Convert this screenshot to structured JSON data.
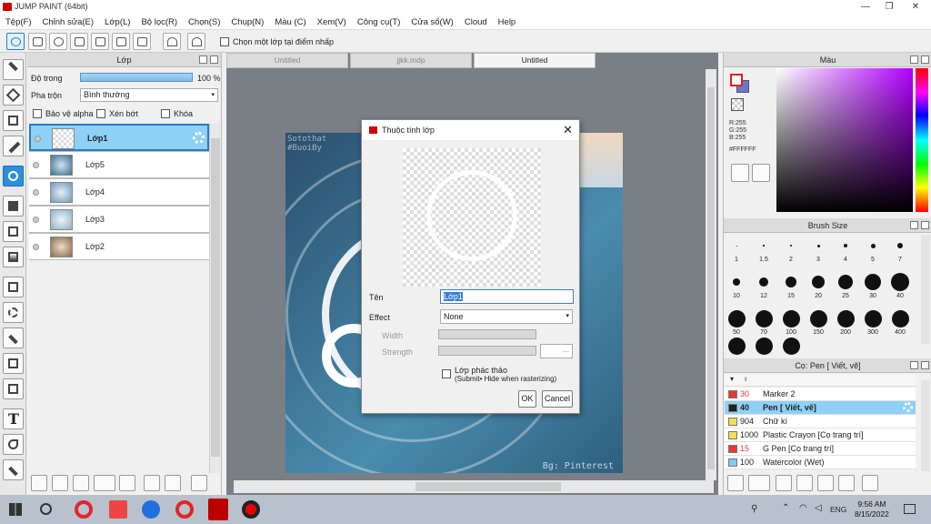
{
  "window": {
    "title": "JUMP PAINT (64bit)",
    "min": "—",
    "max": "❐",
    "close": "✕"
  },
  "menu": [
    "Tệp(F)",
    "Chỉnh sửa(E)",
    "Lớp(L)",
    "Bộ lọc(R)",
    "Chọn(S)",
    "Chụp(N)",
    "Màu (C)",
    "Xem(V)",
    "Công cụ(T)",
    "Cửa sổ(W)",
    "Cloud",
    "Help"
  ],
  "toolbar": {
    "pick_layer_label": "Chọn một lớp tại điểm nhấp"
  },
  "layer_panel": {
    "title": "Lớp",
    "opacity_label": "Độ trong",
    "opacity_value": "100 %",
    "opacity": 1.0,
    "blend_label": "Pha trộn",
    "blend_value": "Bình thường",
    "protect_alpha": "Bảo vệ alpha",
    "clipping": "Xén bớt",
    "lock": "Khóa",
    "layers": [
      {
        "name": "Lớp1",
        "active": true
      },
      {
        "name": "Lớp5",
        "active": false
      },
      {
        "name": "Lớp4",
        "active": false
      },
      {
        "name": "Lớp3",
        "active": false
      },
      {
        "name": "Lớp2",
        "active": false
      }
    ]
  },
  "tabs": [
    {
      "label": "Untitled",
      "active": false
    },
    {
      "label": "jjkk.mdp",
      "active": false
    },
    {
      "label": "Untitled",
      "active": true
    }
  ],
  "canvas": {
    "watermark_top": "Sotothat\n#BuoiBy",
    "watermark_bottom": "Bg: Pinterest"
  },
  "dialog": {
    "title": "Thuộc tính lớp",
    "name_label": "Tên",
    "name_value": "Lớp1",
    "effect_label": "Effect",
    "effect_value": "None",
    "width_label": "Width",
    "strength_label": "Strength",
    "strength_btn": "...",
    "draft_label": "Lớp phác thảo",
    "draft_sub": "(Submit• Hide when rasterizing)",
    "ok": "OK",
    "cancel": "Cancel"
  },
  "color_panel": {
    "title": "Màu",
    "r": "R:255",
    "g": "G:255",
    "b": "B:255",
    "hex": "#FFFFFF"
  },
  "brush_size_panel": {
    "title": "Brush Size",
    "sizes": [
      "1",
      "1.5",
      "2",
      "3",
      "4",
      "5",
      "7",
      "10",
      "12",
      "15",
      "20",
      "25",
      "30",
      "40",
      "50",
      "70",
      "100",
      "150",
      "200",
      "300",
      "400"
    ]
  },
  "brush_panel": {
    "title": "Cọ: Pen [ Viết, vẽ]",
    "brushes": [
      {
        "size": "30",
        "name": "Marker 2",
        "color": "#e53935",
        "active": false
      },
      {
        "size": "40",
        "name": "Pen [ Viết, vẽ]",
        "color": "#222222",
        "active": true
      },
      {
        "size": "904",
        "name": "Chữ kí",
        "color": "#f4e04d",
        "active": false
      },
      {
        "size": "1000",
        "name": "Plastic Crayon [Cọ trang trí]",
        "color": "#f4e04d",
        "active": false
      },
      {
        "size": "15",
        "name": "G Pen [Cọ trang trí]",
        "color": "#e53935",
        "active": false
      },
      {
        "size": "100",
        "name": "Watercolor (Wet)",
        "color": "#7ecbea",
        "active": false
      }
    ]
  },
  "taskbar": {
    "time": "9:56 AM",
    "date": "8/15/2022",
    "lang": "ENG"
  }
}
